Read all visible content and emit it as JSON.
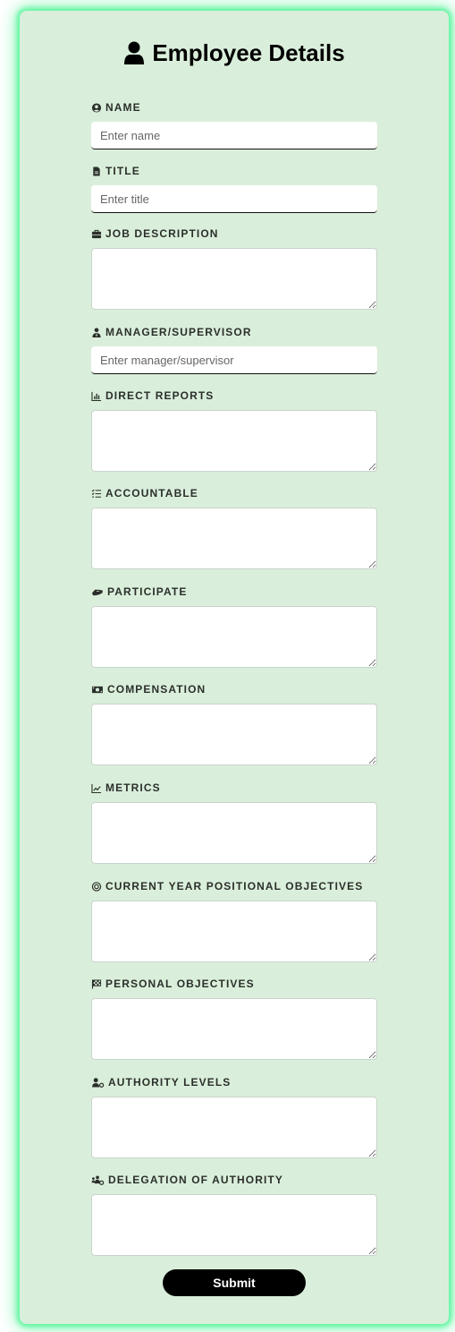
{
  "form": {
    "title": "Employee Details",
    "title_icon": "user-icon",
    "fields": [
      {
        "key": "name",
        "label": "NAME",
        "icon": "user-circle-icon",
        "type": "input",
        "placeholder": "Enter name",
        "value": ""
      },
      {
        "key": "title",
        "label": "TITLE",
        "icon": "file-icon",
        "type": "input",
        "placeholder": "Enter title",
        "value": ""
      },
      {
        "key": "job_description",
        "label": "JOB DESCRIPTION",
        "icon": "briefcase-icon",
        "type": "textarea",
        "value": ""
      },
      {
        "key": "manager",
        "label": "MANAGER/SUPERVISOR",
        "icon": "user-tie-icon",
        "type": "input",
        "placeholder": "Enter manager/supervisor",
        "value": ""
      },
      {
        "key": "direct_reports",
        "label": "DIRECT REPORTS",
        "icon": "chart-bar-icon",
        "type": "textarea",
        "value": ""
      },
      {
        "key": "accountable",
        "label": "ACCOUNTABLE",
        "icon": "list-check-icon",
        "type": "textarea",
        "value": ""
      },
      {
        "key": "participate",
        "label": "PARTICIPATE",
        "icon": "handshake-icon",
        "type": "textarea",
        "value": ""
      },
      {
        "key": "compensation",
        "label": "COMPENSATION",
        "icon": "money-bill-icon",
        "type": "textarea",
        "value": ""
      },
      {
        "key": "metrics",
        "label": "METRICS",
        "icon": "chart-line-icon",
        "type": "textarea",
        "value": ""
      },
      {
        "key": "current_year_objectives",
        "label": "CURRENT YEAR POSITIONAL OBJECTIVES",
        "icon": "bullseye-icon",
        "type": "textarea",
        "value": ""
      },
      {
        "key": "personal_objectives",
        "label": "PERSONAL OBJECTIVES",
        "icon": "flag-checkered-icon",
        "type": "textarea",
        "value": ""
      },
      {
        "key": "authority_levels",
        "label": "AUTHORITY LEVELS",
        "icon": "user-cog-icon",
        "type": "textarea",
        "value": ""
      },
      {
        "key": "delegation_of_authority",
        "label": "DELEGATION OF AUTHORITY",
        "icon": "users-cog-icon",
        "type": "textarea",
        "value": ""
      }
    ],
    "submit_label": "Submit"
  },
  "colors": {
    "card_background": "#daefdb",
    "glow": "#5cf59f",
    "button_background": "#000000",
    "button_text": "#ffffff"
  }
}
